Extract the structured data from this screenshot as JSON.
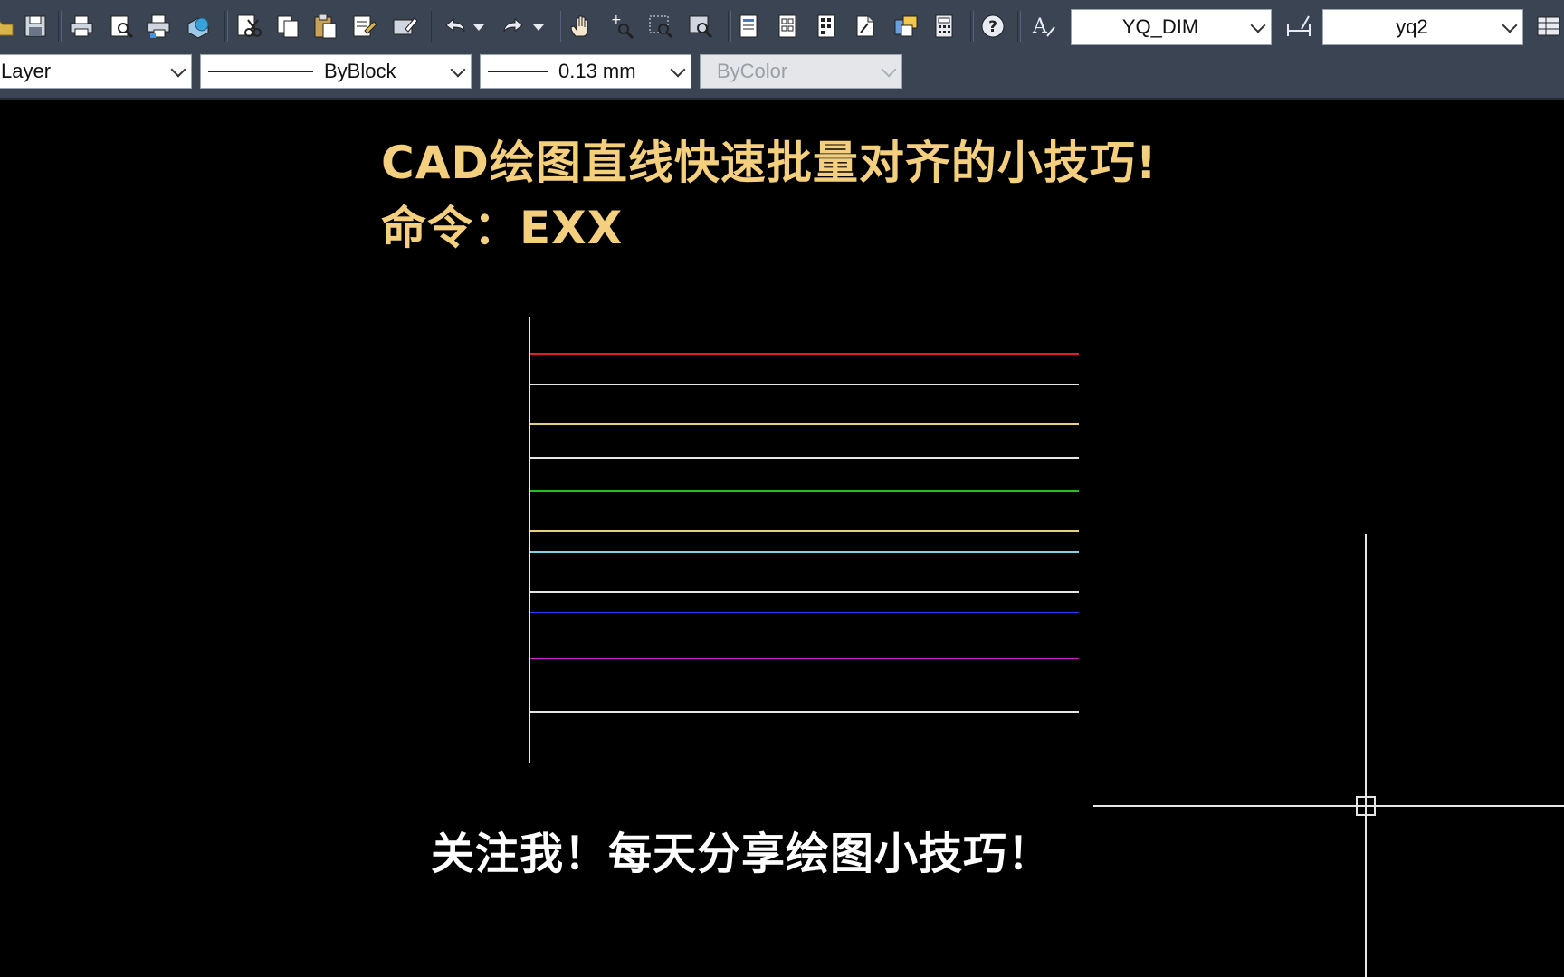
{
  "toolbar": {
    "icons": [
      "open-icon",
      "save-icon",
      "print-icon",
      "print-preview-icon",
      "publish-icon",
      "3d-view-icon",
      "cut-icon",
      "copy-icon",
      "paste-icon",
      "match-properties-icon",
      "block-editor-icon",
      "undo-icon",
      "undo-dropdown-icon",
      "redo-icon",
      "redo-dropdown-icon",
      "pan-icon",
      "zoom-realtime-icon",
      "zoom-window-icon",
      "zoom-previous-icon",
      "properties-icon",
      "design-center-icon",
      "tool-palettes-icon",
      "sheet-set-icon",
      "markup-icon",
      "quick-calc-icon",
      "help-icon",
      "text-style-icon",
      "dim-style-icon",
      "table-style-icon"
    ],
    "dim_style": "YQ_DIM",
    "mleader_style": "yq2"
  },
  "properties": {
    "layer": "Layer",
    "linetype": "ByBlock",
    "lineweight": "0.13 mm",
    "plot_style": "ByColor"
  },
  "canvas": {
    "title_line1": "CAD绘图直线快速批量对齐的小技巧!",
    "title_line2": "命令：EXX",
    "footer": "关注我！每天分享绘图小技巧！",
    "lines": [
      {
        "color": "#e02020"
      },
      {
        "color": "#e6e6e6"
      },
      {
        "color": "#e8d080"
      },
      {
        "color": "#e6e6e6"
      },
      {
        "color": "#22c022"
      },
      {
        "color": "#e8d080"
      },
      {
        "color": "#7ed4e6"
      },
      {
        "color": "#e6e6e6"
      },
      {
        "color": "#2a3cff"
      },
      {
        "color": "#d020d0"
      },
      {
        "color": "#e6e6e6"
      }
    ]
  }
}
